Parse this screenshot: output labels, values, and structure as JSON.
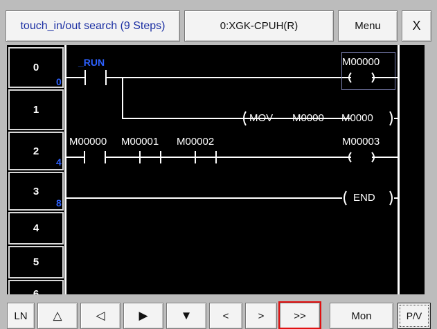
{
  "title_bar": {
    "search_label": "touch_in/out search (9 Steps)",
    "cpu_label": "0:XGK-CPUH(R)",
    "menu_label": "Menu",
    "close_label": "X"
  },
  "ladder": {
    "rows": [
      {
        "number": "0",
        "step": "0"
      },
      {
        "number": "1",
        "step": ""
      },
      {
        "number": "2",
        "step": "4"
      },
      {
        "number": "3",
        "step": "8"
      },
      {
        "number": "4",
        "step": ""
      },
      {
        "number": "5",
        "step": ""
      },
      {
        "number": "6",
        "step": ""
      }
    ],
    "rung0": {
      "contact": "_RUN",
      "coil": "M00000"
    },
    "rung1": {
      "instruction": "MOV",
      "source": "M0000",
      "dest": "M0000"
    },
    "rung2": {
      "contacts": [
        "M00000",
        "M00001",
        "M00002"
      ],
      "coil": "M00003"
    },
    "rung3": {
      "instruction": "END"
    }
  },
  "toolbar": {
    "ln_label": "LN",
    "up_label": "△",
    "left_label": "◁",
    "right_label": "▶",
    "down_label": "▼",
    "prev_label": "<",
    "next_label": ">",
    "last_label": ">>",
    "mon_label": "Mon",
    "pv_label": "P/V",
    "highlight_color": "#e01010"
  }
}
